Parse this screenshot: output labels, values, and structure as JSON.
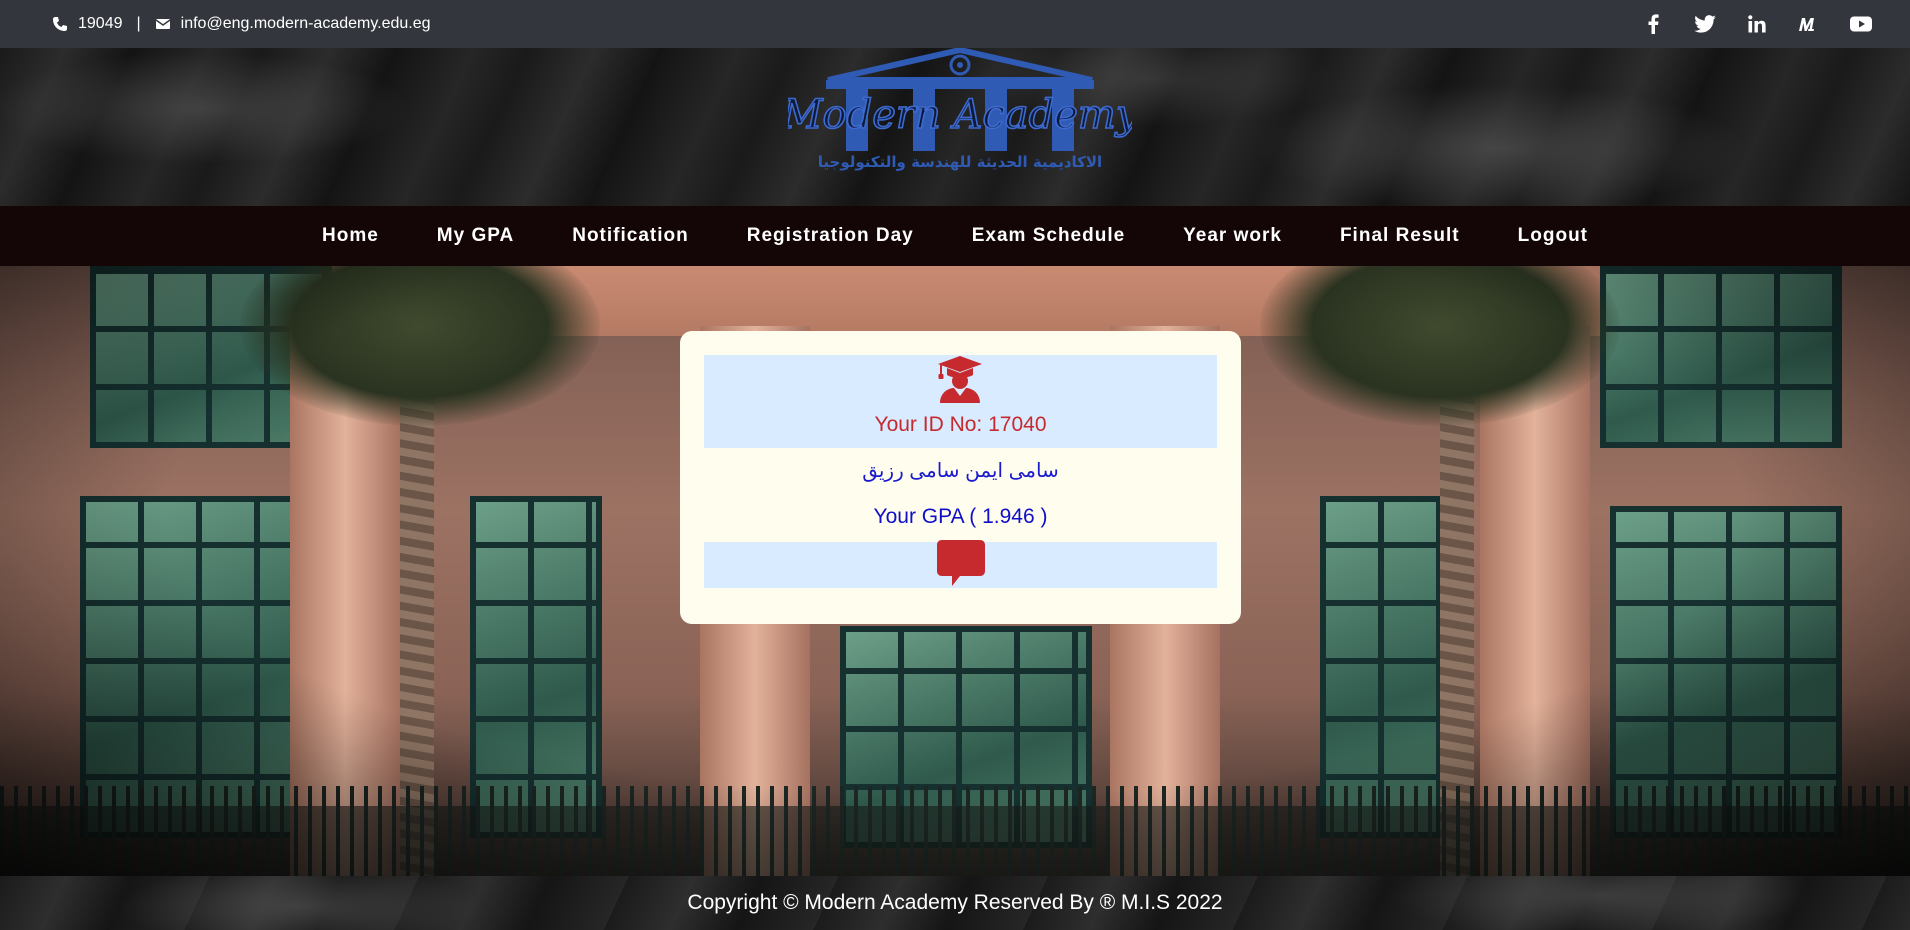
{
  "topbar": {
    "phone": "19049",
    "separator": "|",
    "email": "info@eng.modern-academy.edu.eg",
    "social_icons": [
      "facebook-icon",
      "twitter-icon",
      "linkedin-icon",
      "medium-icon",
      "youtube-icon"
    ]
  },
  "logo": {
    "name_en": "Modern Academy",
    "name_ar": "الاكاديمية الحديثة للهندسة والتكنولوجيا"
  },
  "nav": {
    "items": [
      {
        "label": "Home"
      },
      {
        "label": "My GPA"
      },
      {
        "label": "Notification"
      },
      {
        "label": "Registration Day"
      },
      {
        "label": "Exam Schedule"
      },
      {
        "label": "Year work"
      },
      {
        "label": "Final Result"
      },
      {
        "label": "Logout"
      }
    ]
  },
  "card": {
    "id_text": "Your ID No: 17040",
    "student_name": "سامى ايمن سامى رزيق",
    "gpa_text": "Your GPA ( 1.946 )",
    "icons": [
      "graduate-icon",
      "chat-bubble-icon"
    ]
  },
  "footer": {
    "copyright": "Copyright © Modern Academy Reserved By ® M.I.S 2022"
  },
  "colors": {
    "topbar_bg": "#33363d",
    "nav_bg": "#140606",
    "card_bg": "#fffdee",
    "band_bg": "#d8ebff",
    "id_red": "#c62a2f",
    "text_blue": "#0f0fc8",
    "logo_blue": "#2f5bb5"
  }
}
